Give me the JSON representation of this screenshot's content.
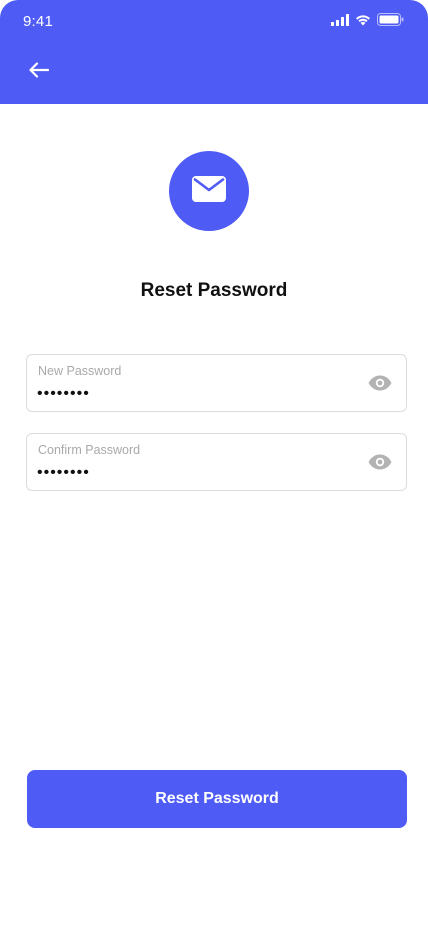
{
  "status_bar": {
    "time": "9:41",
    "icons": [
      "signal-icon",
      "wifi-icon",
      "battery-icon"
    ]
  },
  "header": {
    "back_icon": "arrow-left-icon"
  },
  "hero": {
    "icon": "mail-icon"
  },
  "page": {
    "title": "Reset Password"
  },
  "form": {
    "new_password": {
      "label": "New Password",
      "value": "password",
      "visibility_icon": "eye-icon"
    },
    "confirm_password": {
      "label": "Confirm Password",
      "value": "password",
      "visibility_icon": "eye-icon"
    }
  },
  "actions": {
    "submit_label": "Reset Password"
  },
  "colors": {
    "primary": "#4f5bf5",
    "label": "#a9a9a9",
    "border": "#dcdcdc",
    "icon_muted": "#b3b3b3"
  }
}
